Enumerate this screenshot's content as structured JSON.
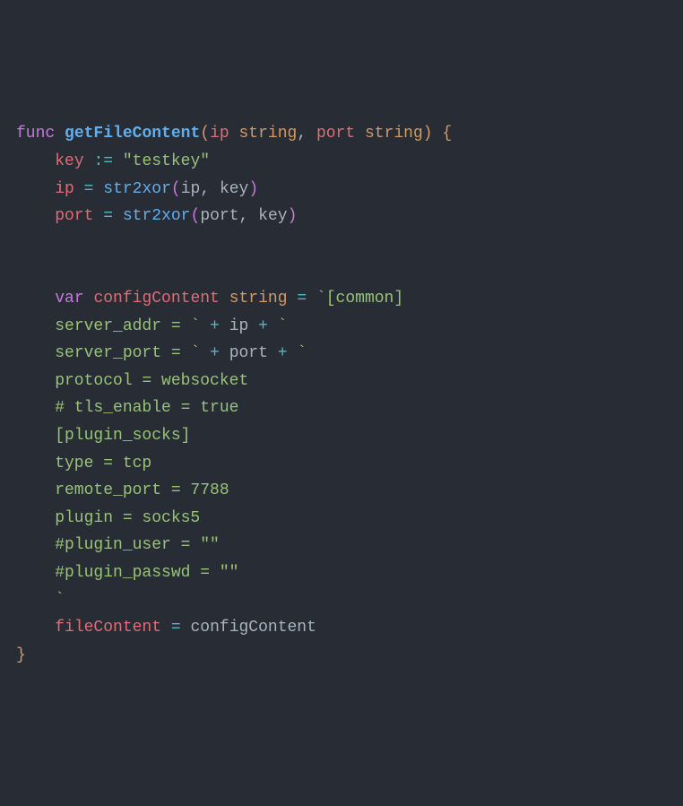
{
  "code": {
    "line1": {
      "func_kw": "func",
      "funcname": "getFileContent",
      "lparen": "(",
      "param1": "ip",
      "type1": "string",
      "comma": ",",
      "param2": "port",
      "type2": "string",
      "rparen": ")",
      "lbrace": "{"
    },
    "line2": {
      "indent": "    ",
      "var": "key",
      "op": ":=",
      "str": "\"testkey\""
    },
    "line3": {
      "indent": "    ",
      "var": "ip",
      "eq": "=",
      "fn": "str2xor",
      "lparen": "(",
      "arg1": "ip",
      "comma": ",",
      "arg2": "key",
      "rparen": ")"
    },
    "line4": {
      "indent": "    ",
      "var": "port",
      "eq": "=",
      "fn": "str2xor",
      "lparen": "(",
      "arg1": "port",
      "comma": ",",
      "arg2": "key",
      "rparen": ")"
    },
    "line7": {
      "indent": "    ",
      "var_kw": "var",
      "varname": "configContent",
      "type": "string",
      "eq": "=",
      "str": "`[common]"
    },
    "line8": {
      "indent": "    ",
      "str1": "server_addr = `",
      "plus1": "+",
      "var": "ip",
      "plus2": "+",
      "str2": "`"
    },
    "line9": {
      "indent": "    ",
      "str1": "server_port = `",
      "plus1": "+",
      "var": "port",
      "plus2": "+",
      "str2": "`"
    },
    "line10": {
      "text": "    protocol = websocket"
    },
    "line11": {
      "text": "    # tls_enable = true"
    },
    "line12": {
      "text": "    [plugin_socks]"
    },
    "line13": {
      "text": "    type = tcp"
    },
    "line14": {
      "text": "    remote_port = 7788"
    },
    "line15": {
      "text": "    plugin = socks5"
    },
    "line16": {
      "text": "    #plugin_user = \"\""
    },
    "line17": {
      "text": "    #plugin_passwd = \"\""
    },
    "line18": {
      "text": "    `"
    },
    "line19": {
      "indent": "    ",
      "var": "fileContent",
      "eq": "=",
      "val": "configContent"
    },
    "line20": {
      "rbrace": "}"
    }
  },
  "chart_data": {
    "type": "table",
    "title": "Go source code defining getFileContent function",
    "language": "go",
    "function_name": "getFileContent",
    "parameters": [
      {
        "name": "ip",
        "type": "string"
      },
      {
        "name": "port",
        "type": "string"
      }
    ],
    "variables": [
      {
        "name": "key",
        "value": "testkey"
      },
      {
        "name": "configContent",
        "type": "string"
      }
    ],
    "config_template_fields": [
      {
        "key": "server_addr",
        "value": "<ip>"
      },
      {
        "key": "server_port",
        "value": "<port>"
      },
      {
        "key": "protocol",
        "value": "websocket"
      },
      {
        "key": "# tls_enable",
        "value": "true"
      },
      {
        "section": "[plugin_socks]"
      },
      {
        "key": "type",
        "value": "tcp"
      },
      {
        "key": "remote_port",
        "value": "7788"
      },
      {
        "key": "plugin",
        "value": "socks5"
      },
      {
        "key": "#plugin_user",
        "value": ""
      },
      {
        "key": "#plugin_passwd",
        "value": ""
      }
    ],
    "assignment": "fileContent = configContent"
  }
}
